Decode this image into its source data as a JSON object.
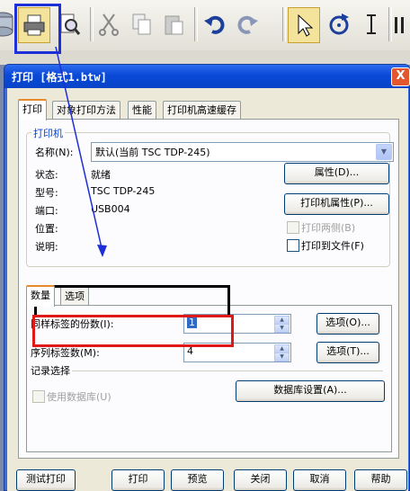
{
  "toolbar": {
    "icons": [
      "database-icon",
      "printer-icon",
      "print-preview-icon",
      "scissors-icon",
      "copy-icon",
      "paste-icon",
      "undo-icon",
      "redo-icon",
      "pointer-icon",
      "rotate-icon",
      "text-cursor-icon",
      "pause-icon"
    ]
  },
  "dialog": {
    "title": "打印 [格式1.btw]",
    "close": "X",
    "tabs": [
      "打印",
      "对象打印方法",
      "性能",
      "打印机高速缓存"
    ],
    "printer_group": {
      "label": "打印机",
      "name_label": "名称(N):",
      "name_value": "默认(当前 TSC TDP-245)",
      "status_label": "状态:",
      "status_value": "就绪",
      "model_label": "型号:",
      "model_value": "TSC TDP-245",
      "port_label": "端口:",
      "port_value": "USB004",
      "location_label": "位置:",
      "comment_label": "说明:",
      "properties_button": "属性(D)...",
      "printer_properties_button": "打印机属性(P)...",
      "duplex_label": "打印两侧(B)",
      "print_to_file_label": "打印到文件(F)"
    },
    "inner_tabs": [
      "数量",
      "选项"
    ],
    "quantity": {
      "copies_label": "同样标签的份数(I):",
      "copies_value": "1",
      "serial_label": "序列标签数(M):",
      "serial_value": "4",
      "options_button_1": "选项(O)...",
      "options_button_2": "选项(T)...",
      "record_group_label": "记录选择",
      "use_database_label": "使用数据库(U)",
      "database_settings_button": "数据库设置(A)..."
    },
    "footer": {
      "test_print": "测试打印",
      "print": "打印",
      "preview": "预览",
      "close": "关闭",
      "cancel": "取消",
      "help": "帮助"
    }
  }
}
